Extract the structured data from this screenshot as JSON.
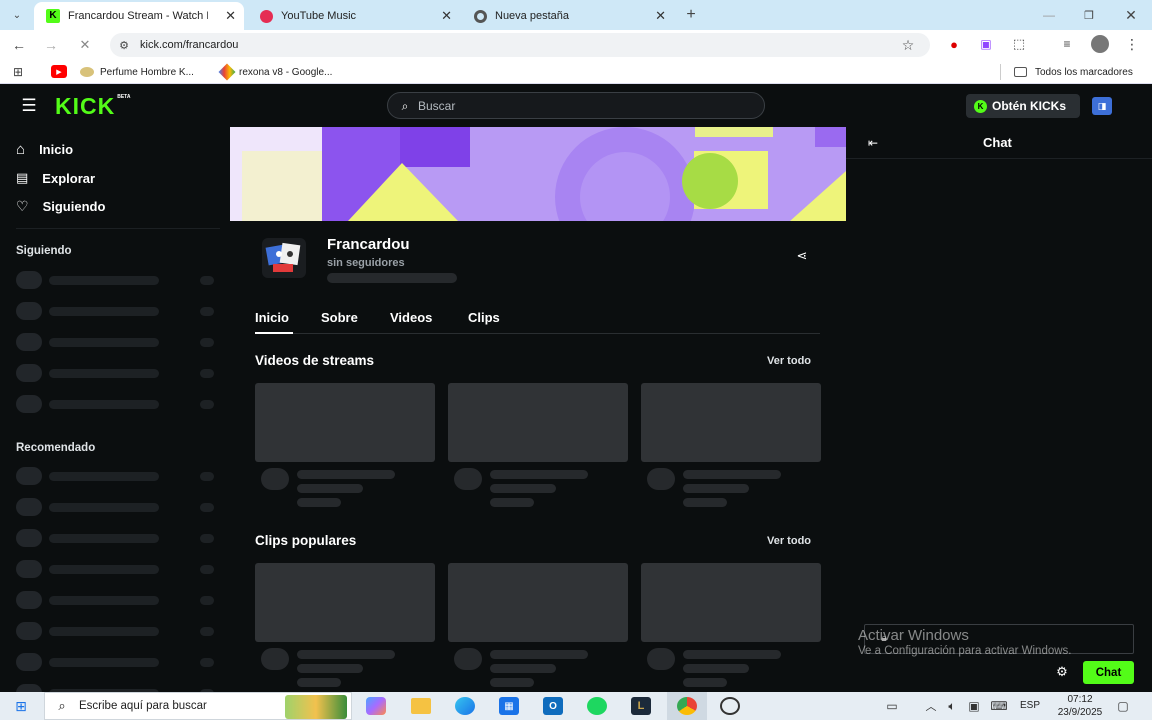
{
  "browser": {
    "tabs": [
      {
        "label": "Francardou Stream - Watch Live",
        "active": true
      },
      {
        "label": "YouTube Music",
        "active": false
      },
      {
        "label": "Nueva pestaña",
        "active": false
      }
    ],
    "url": "kick.com/francardou",
    "bookmarks": [
      {
        "label": "Perfume Hombre K..."
      },
      {
        "label": "rexona v8 - Google..."
      }
    ],
    "all_bookmarks": "Todos los marcadores"
  },
  "kick": {
    "logo": "KICK",
    "logo_badge": "BETA",
    "search_placeholder": "Buscar",
    "get_kicks": "Obtén KICKs",
    "nav": [
      {
        "label": "Inicio",
        "icon": "home-icon"
      },
      {
        "label": "Explorar",
        "icon": "compass-icon"
      },
      {
        "label": "Siguiendo",
        "icon": "heart-icon"
      }
    ],
    "following_header": "Siguiendo",
    "recommended_header": "Recomendado",
    "channel": {
      "name": "Francardou",
      "followers": "sin seguidores"
    },
    "channel_tabs": [
      "Inicio",
      "Sobre",
      "Videos",
      "Clips"
    ],
    "sections": {
      "streams_title": "Videos de streams",
      "streams_link": "Ver todo",
      "clips_title": "Clips populares",
      "clips_link": "Ver todo"
    },
    "chat": {
      "title": "Chat",
      "button": "Chat"
    },
    "accent": "#53fc18"
  },
  "watermark": {
    "line1": "Activar Windows",
    "line2": "Ve a Configuración para activar Windows."
  },
  "taskbar": {
    "search_placeholder": "Escribe aquí para buscar",
    "lang": "ESP",
    "time": "07:12",
    "date": "23/9/2025"
  }
}
